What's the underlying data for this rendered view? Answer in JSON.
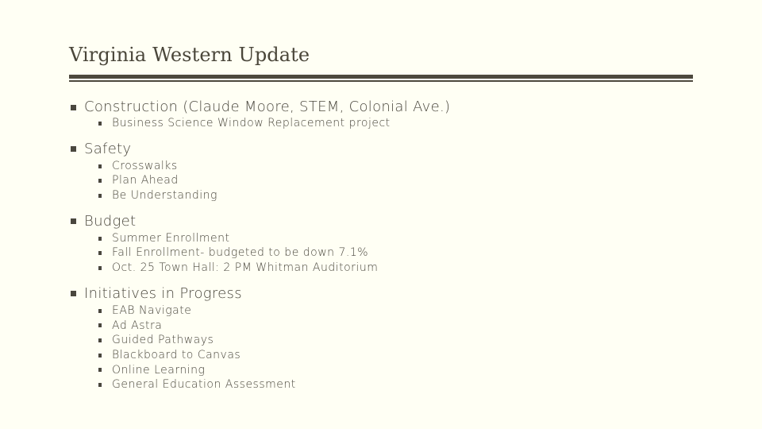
{
  "slide": {
    "title": "Virginia Western Update",
    "sections": [
      {
        "heading": "Construction (Claude Moore, STEM, Colonial Ave.)",
        "items": [
          "Business Science Window Replacement project"
        ]
      },
      {
        "heading": "Safety",
        "items": [
          "Crosswalks",
          "Plan Ahead",
          "Be Understanding"
        ]
      },
      {
        "heading": "Budget",
        "items": [
          "Summer Enrollment",
          "Fall Enrollment- budgeted to be down 7.1%",
          "Oct. 25 Town Hall: 2 PM Whitman Auditorium"
        ]
      },
      {
        "heading": "Initiatives in Progress",
        "items": [
          "EAB Navigate",
          "Ad Astra",
          "Guided Pathways",
          "Blackboard to Canvas",
          "Online Learning",
          "General Education Assessment"
        ]
      }
    ]
  },
  "colors": {
    "background": "#fffff4",
    "text": "#4a473e",
    "rule": "#4d493e"
  }
}
